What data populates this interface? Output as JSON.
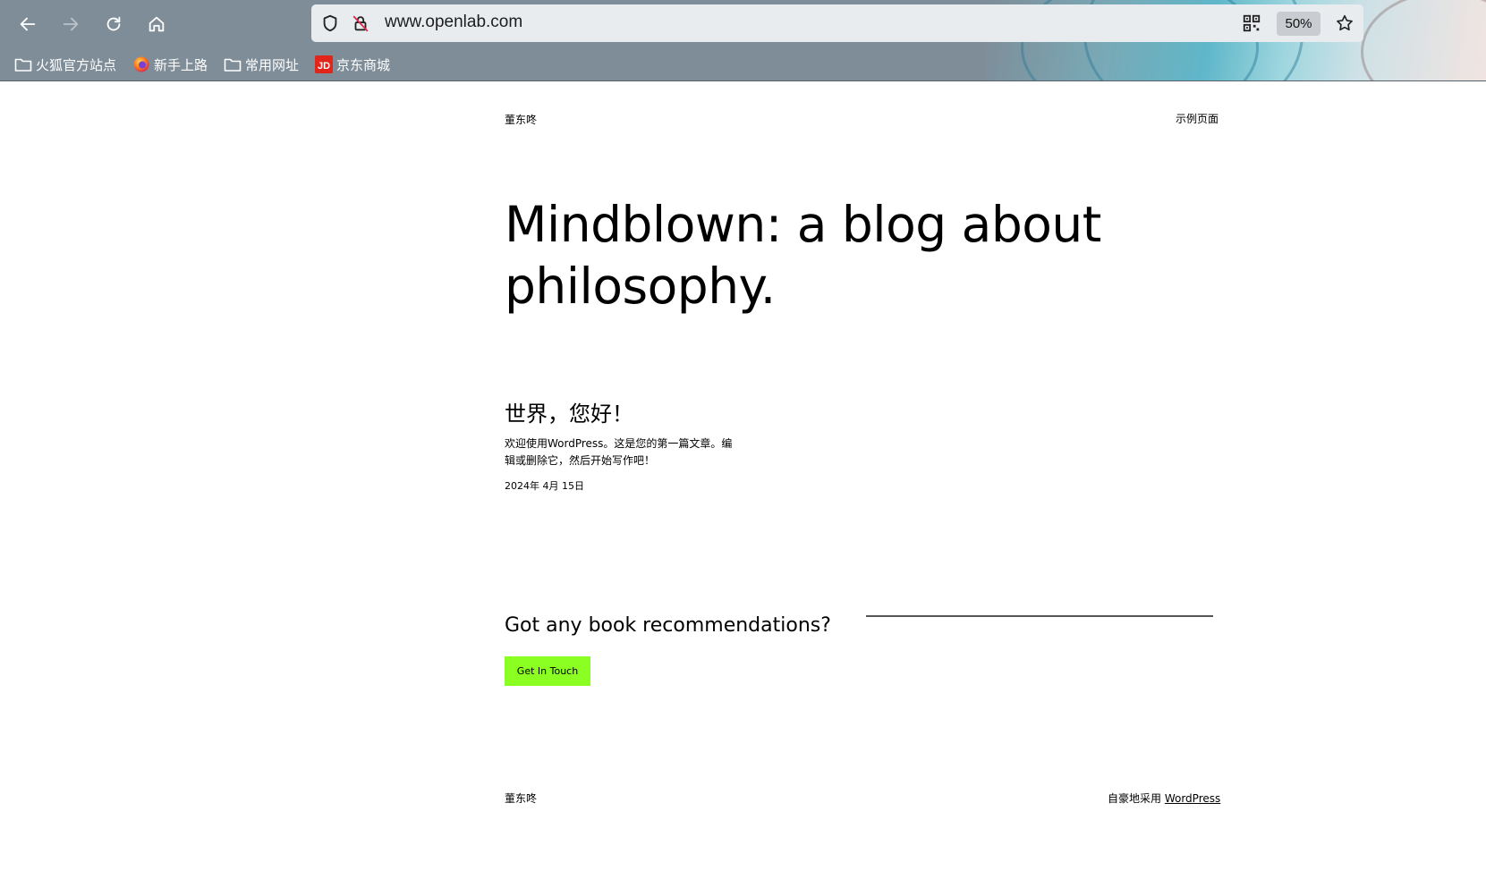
{
  "browser": {
    "url": "www.openlab.com",
    "zoom": "50%",
    "bookmarks": [
      {
        "label": "火狐官方站点",
        "icon": "folder-icon"
      },
      {
        "label": "新手上路",
        "icon": "firefox-icon"
      },
      {
        "label": "常用网址",
        "icon": "folder-icon"
      },
      {
        "label": "京东商城",
        "icon": "jd-icon"
      }
    ]
  },
  "header": {
    "site_title": "董东咚",
    "nav_link": "示例页面"
  },
  "hero": {
    "title": "Mindblown: a blog about philosophy."
  },
  "post": {
    "title": "世界，您好！",
    "excerpt": "欢迎使用WordPress。这是您的第一篇文章。编辑或删除它，然后开始写作吧！",
    "date": "2024年 4月 15日"
  },
  "cta": {
    "heading": "Got any book recommendations?",
    "button_label": "Get In Touch",
    "button_color": "#8cff22"
  },
  "footer": {
    "site_title": "董东咚",
    "credit_prefix": "自豪地采用 ",
    "credit_link": "WordPress"
  }
}
